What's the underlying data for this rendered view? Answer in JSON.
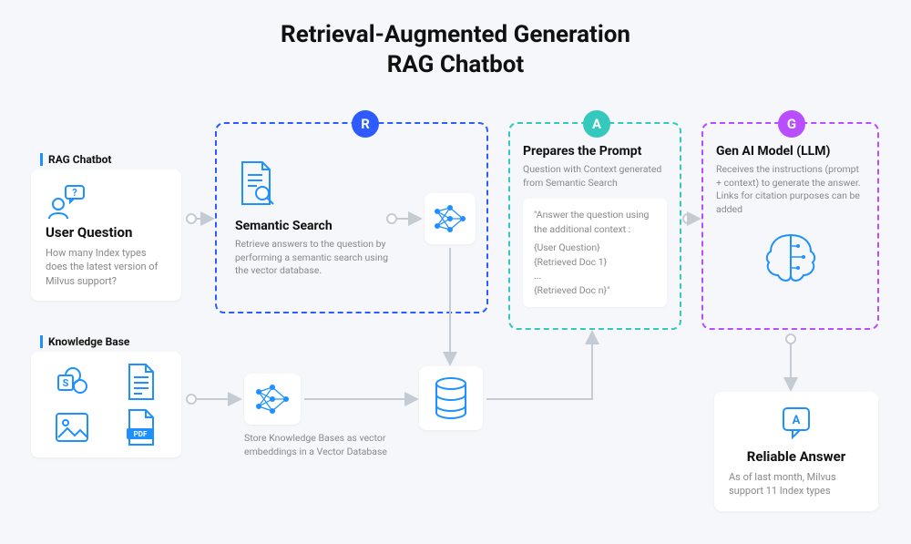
{
  "title_line1": "Retrieval-Augmented Generation",
  "title_line2": "RAG Chatbot",
  "rag_label": "RAG Chatbot",
  "user": {
    "title": "User Question",
    "desc": "How many Index types does the latest version of Milvus support?"
  },
  "kb_label": "Knowledge Base",
  "embeddings_desc": "Store Knowledge Bases as vector embeddings in a Vector Database",
  "r": {
    "letter": "R",
    "title": "Semantic Search",
    "desc": "Retrieve answers to the question by performing a semantic search using the vector database."
  },
  "a": {
    "letter": "A",
    "title": "Prepares the Prompt",
    "desc": "Question with Context generated from Semantic Search",
    "prompt_l1": "\"Answer the question using the additional context :",
    "prompt_l2": "{User Question}",
    "prompt_l3": "{Retrieved Doc 1}",
    "prompt_l4": "...",
    "prompt_l5": "{Retrieved Doc n}\""
  },
  "g": {
    "letter": "G",
    "title": "Gen AI Model (LLM)",
    "desc": "Receives the instructions (prompt + context) to generate the answer. Links for citation purposes can be added"
  },
  "answer": {
    "title": "Reliable Answer",
    "desc": "As of last month, Milvus support 11 Index types"
  },
  "colors": {
    "r": "#2e5bff",
    "a": "#35c9bd",
    "g": "#b84eff",
    "accent": "#1e90ff"
  }
}
